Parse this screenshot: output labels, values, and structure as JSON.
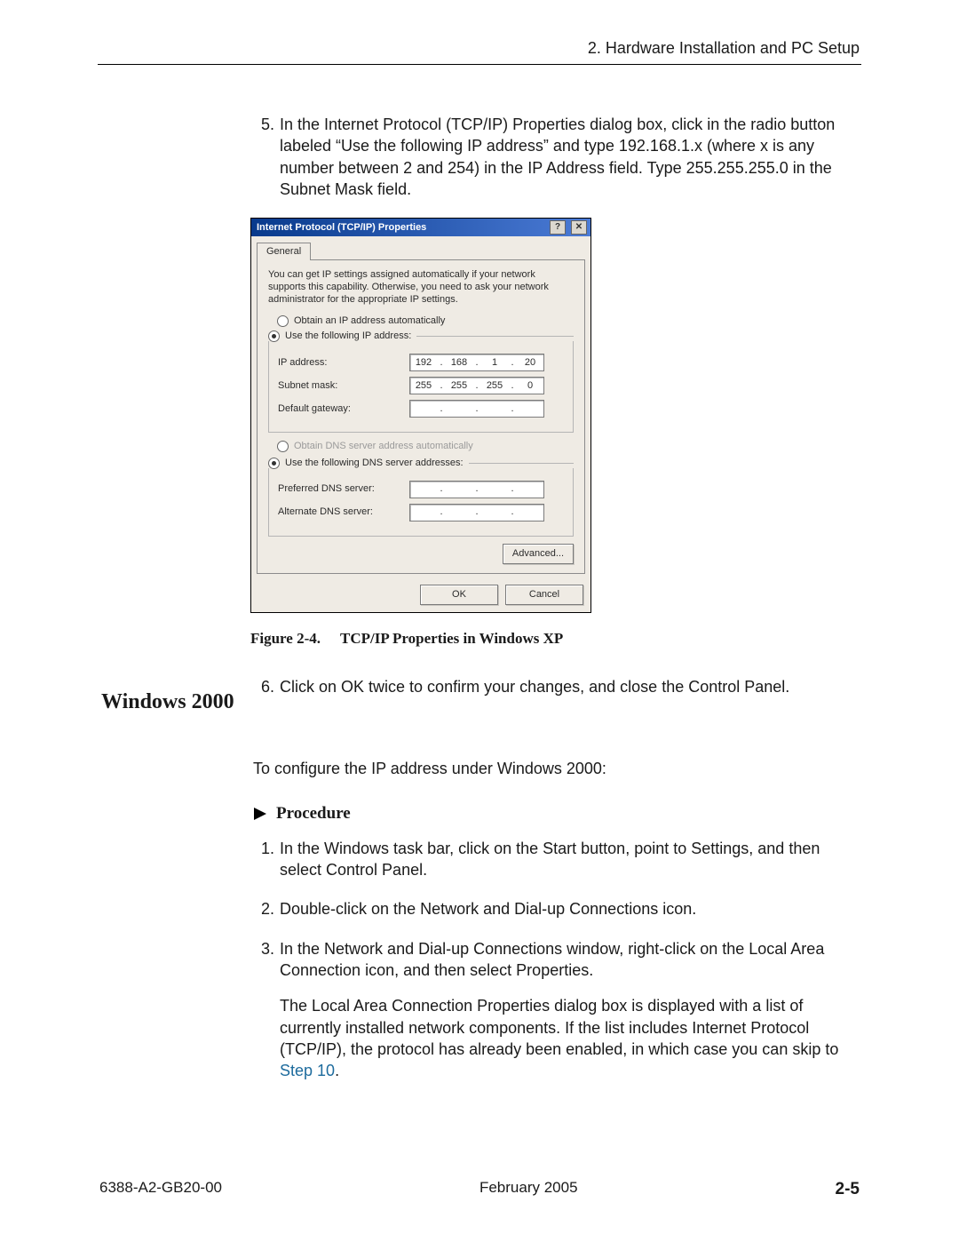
{
  "header": {
    "chapter": "2. Hardware Installation and PC Setup"
  },
  "step5": {
    "n": "5.",
    "text": "In the Internet Protocol (TCP/IP) Properties dialog box, click in the radio button labeled “Use the following IP address” and type 192.168.1.x (where x is any number between 2 and 254) in the IP Address field. Type 255.255.255.0 in the Subnet Mask field."
  },
  "dlg": {
    "title": "Internet Protocol (TCP/IP) Properties",
    "help_glyph": "?",
    "close_glyph": "✕",
    "tab": "General",
    "intro": "You can get IP settings assigned automatically if your network supports this capability. Otherwise, you need to ask your network administrator for the appropriate IP settings.",
    "radio_auto_ip": "Obtain an IP address automatically",
    "radio_static_ip": "Use the following IP address:",
    "lbl_ip": "IP address:",
    "lbl_mask": "Subnet mask:",
    "lbl_gw": "Default gateway:",
    "ip": {
      "o1": "192",
      "o2": "168",
      "o3": "1",
      "o4": "20"
    },
    "mask": {
      "o1": "255",
      "o2": "255",
      "o3": "255",
      "o4": "0"
    },
    "gw": {
      "o1": "",
      "o2": "",
      "o3": "",
      "o4": ""
    },
    "radio_auto_dns": "Obtain DNS server address automatically",
    "radio_static_dns": "Use the following DNS server addresses:",
    "lbl_pref_dns": "Preferred DNS server:",
    "lbl_alt_dns": "Alternate DNS server:",
    "pdns": {
      "o1": "",
      "o2": "",
      "o3": "",
      "o4": ""
    },
    "adns": {
      "o1": "",
      "o2": "",
      "o3": "",
      "o4": ""
    },
    "advanced": "Advanced...",
    "ok": "OK",
    "cancel": "Cancel"
  },
  "figcap": {
    "label": "Figure 2-4.",
    "title": "TCP/IP Properties in Windows XP"
  },
  "step6": {
    "n": "6.",
    "text": "Click on OK twice to confirm your changes, and close the Control Panel."
  },
  "h2": "Windows 2000",
  "lead": "To configure the IP address under Windows 2000:",
  "procedure": "Procedure",
  "p1": {
    "n": "1.",
    "text": "In the Windows task bar, click on the Start button, point to Settings, and then select Control Panel."
  },
  "p2": {
    "n": "2.",
    "text": "Double-click on the Network and Dial-up Connections icon."
  },
  "p3": {
    "n": "3.",
    "text": "In the Network and Dial-up Connections window, right-click on the Local Area Connection icon, and then select Properties."
  },
  "p3b_pre": "The Local Area Connection Properties dialog box is displayed with a list of currently installed network components. If the list includes Internet Protocol (TCP/IP), the protocol has already been enabled, in which case you can skip to ",
  "p3b_link": "Step 10",
  "p3b_post": ".",
  "footer": {
    "doc": "6388-A2-GB20-00",
    "date": "February 2005",
    "page": "2-5"
  }
}
